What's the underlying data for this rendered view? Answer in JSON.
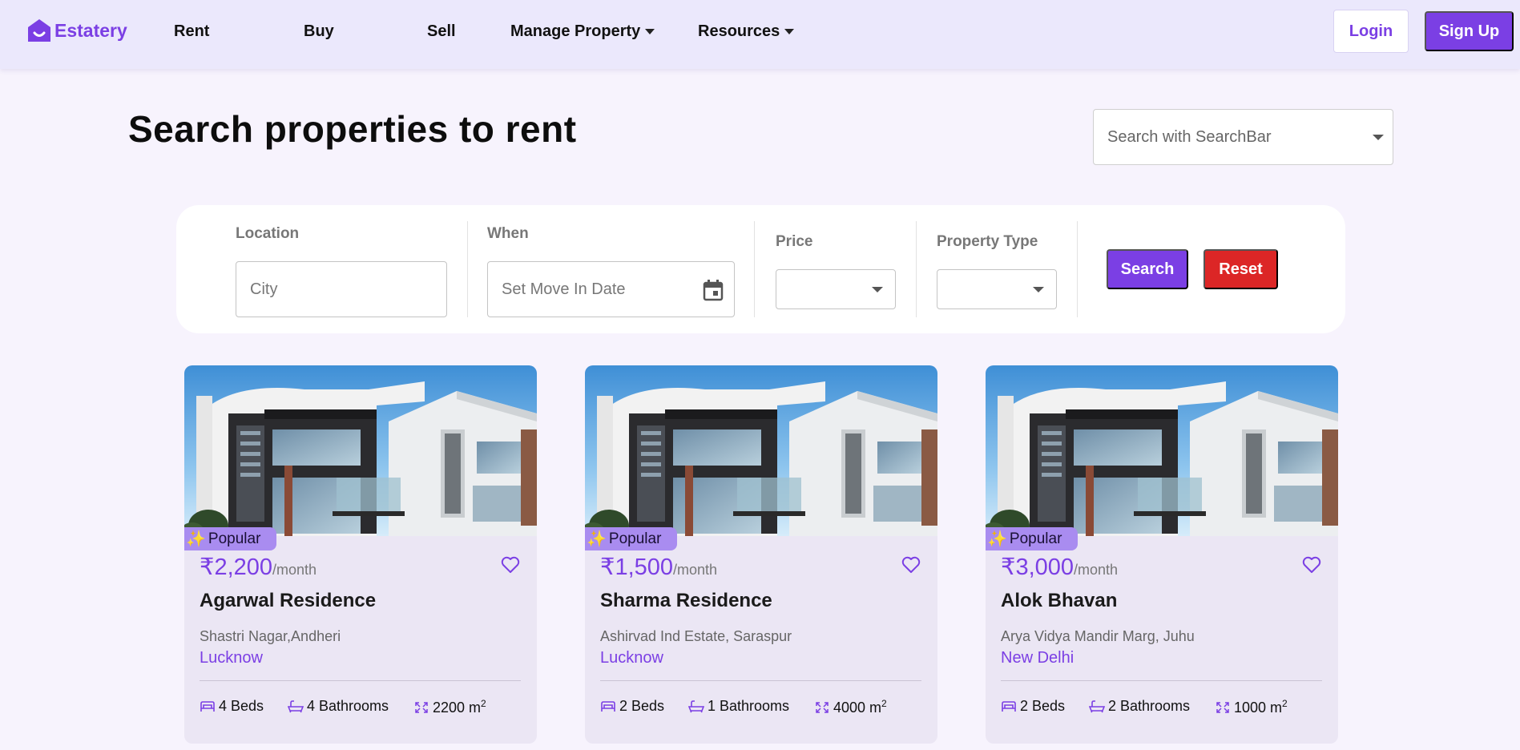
{
  "brand": {
    "name": "Estatery",
    "color": "#7b3fe4"
  },
  "nav": {
    "links": [
      {
        "label": "Rent"
      },
      {
        "label": "Buy"
      },
      {
        "label": "Sell"
      },
      {
        "label": "Manage Property",
        "dropdown": true
      },
      {
        "label": "Resources",
        "dropdown": true
      }
    ],
    "login_label": "Login",
    "signup_label": "Sign Up"
  },
  "page": {
    "title": "Search properties to rent",
    "searchbar_placeholder": "Search with SearchBar"
  },
  "filters": {
    "location": {
      "label": "Location",
      "placeholder": "City"
    },
    "when": {
      "label": "When",
      "placeholder": "Set Move In Date",
      "icon": "calendar-icon"
    },
    "price": {
      "label": "Price",
      "value": ""
    },
    "property_type": {
      "label": "Property Type",
      "value": ""
    },
    "search_label": "Search",
    "reset_label": "Reset"
  },
  "properties": [
    {
      "badge": "Popular",
      "price": "₹2,200",
      "period": "/month",
      "name": "Agarwal Residence",
      "address": "Shastri Nagar,Andheri",
      "city": "Lucknow",
      "beds": "4 Beds",
      "baths": "4 Bathrooms",
      "area": "2200 m",
      "area_unit_exp": "2"
    },
    {
      "badge": "Popular",
      "price": "₹1,500",
      "period": "/month",
      "name": "Sharma Residence",
      "address": "Ashirvad Ind Estate, Saraspur",
      "city": "Lucknow",
      "beds": "2 Beds",
      "baths": "1 Bathrooms",
      "area": "4000 m",
      "area_unit_exp": "2"
    },
    {
      "badge": "Popular",
      "price": "₹3,000",
      "period": "/month",
      "name": "Alok Bhavan",
      "address": "Arya Vidya Mandir Marg, Juhu",
      "city": "New Delhi",
      "beds": "2 Beds",
      "baths": "2 Bathrooms",
      "area": "1000 m",
      "area_unit_exp": "2"
    }
  ]
}
